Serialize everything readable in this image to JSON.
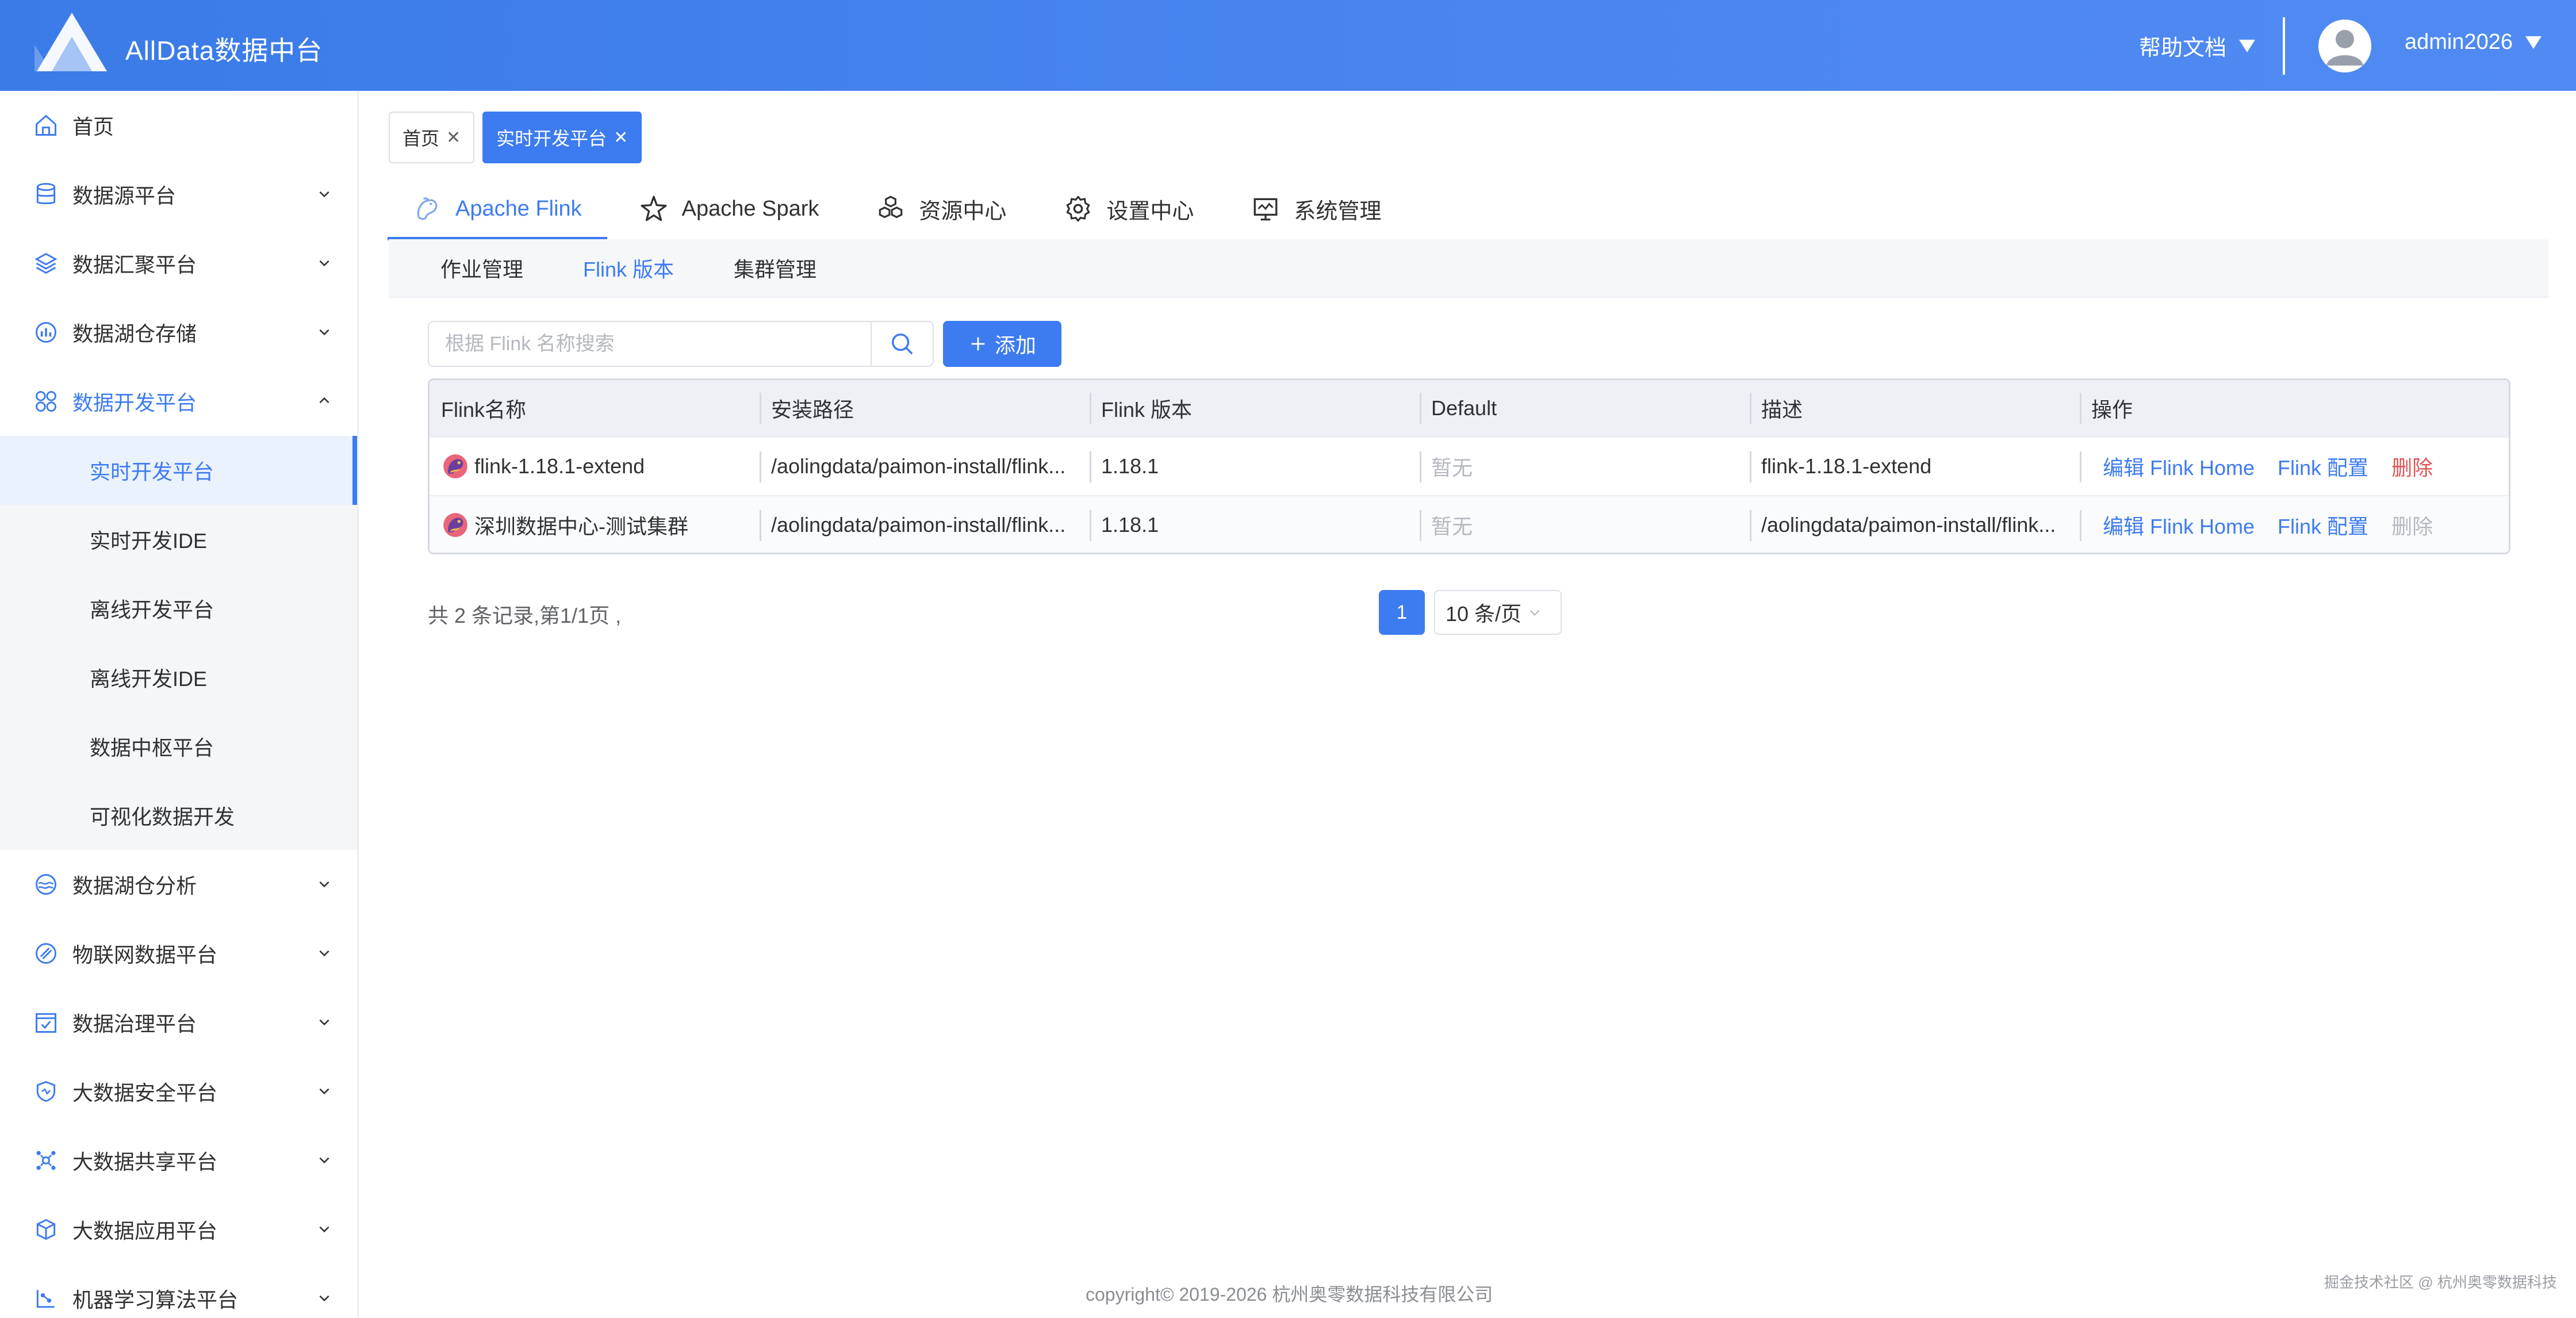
{
  "header": {
    "app_title": "AllData数据中台",
    "help_label": "帮助文档",
    "username": "admin2026"
  },
  "sidebar": {
    "items": [
      {
        "label": "首页",
        "icon": "home-icon"
      },
      {
        "label": "数据源平台",
        "icon": "database-icon"
      },
      {
        "label": "数据汇聚平台",
        "icon": "layers-icon"
      },
      {
        "label": "数据湖仓存储",
        "icon": "chart-circle-icon"
      },
      {
        "label": "数据开发平台",
        "icon": "grid-icon",
        "expanded": true
      },
      {
        "label": "数据湖仓分析",
        "icon": "lake-icon"
      },
      {
        "label": "物联网数据平台",
        "icon": "iot-icon"
      },
      {
        "label": "数据治理平台",
        "icon": "checklist-icon"
      },
      {
        "label": "大数据安全平台",
        "icon": "shield-icon"
      },
      {
        "label": "大数据共享平台",
        "icon": "share-icon"
      },
      {
        "label": "大数据应用平台",
        "icon": "cube-icon"
      },
      {
        "label": "机器学习算法平台",
        "icon": "ml-icon"
      }
    ],
    "subitems": [
      {
        "label": "实时开发平台",
        "selected": true
      },
      {
        "label": "实时开发IDE"
      },
      {
        "label": "离线开发平台"
      },
      {
        "label": "离线开发IDE"
      },
      {
        "label": "数据中枢平台"
      },
      {
        "label": "可视化数据开发"
      }
    ]
  },
  "tags": [
    {
      "label": "首页"
    },
    {
      "label": "实时开发平台",
      "active": true
    }
  ],
  "tabs": [
    {
      "label": "Apache Flink",
      "icon": "flink-squirrel-icon",
      "active": true
    },
    {
      "label": "Apache Spark",
      "icon": "spark-star-icon"
    },
    {
      "label": "资源中心",
      "icon": "resource-cubes-icon"
    },
    {
      "label": "设置中心",
      "icon": "settings-gear-icon"
    },
    {
      "label": "系统管理",
      "icon": "monitor-icon"
    }
  ],
  "subtabs": [
    {
      "label": "作业管理"
    },
    {
      "label": "Flink 版本",
      "active": true
    },
    {
      "label": "集群管理"
    }
  ],
  "search": {
    "placeholder": "根据 Flink 名称搜索",
    "value": ""
  },
  "add_label": "添加",
  "table": {
    "columns": [
      "Flink名称",
      "安装路径",
      "Flink 版本",
      "Default",
      "描述",
      "操作"
    ],
    "rows": [
      {
        "name": "flink-1.18.1-extend",
        "path": "/aolingdata/paimon-install/flink...",
        "version": "1.18.1",
        "default": "暂无",
        "description": "flink-1.18.1-extend",
        "delete_enabled": true
      },
      {
        "name": "深圳数据中心-测试集群",
        "path": "/aolingdata/paimon-install/flink...",
        "version": "1.18.1",
        "default": "暂无",
        "description": "/aolingdata/paimon-install/flink...",
        "delete_enabled": false
      }
    ],
    "actions": {
      "edit_home": "编辑 Flink Home",
      "config": "Flink 配置",
      "delete": "删除"
    }
  },
  "pagination": {
    "summary": "共 2 条记录,第1/1页 ,",
    "current_page": "1",
    "page_size": "10 条/页"
  },
  "footer": {
    "copyright": "copyright© 2019-2026 杭州奥零数据科技有限公司",
    "watermark": "掘金技术社区 @ 杭州奥零数据科技"
  },
  "colors": {
    "primary": "#3d7bf0",
    "header_gradient_start": "#3a7be8",
    "danger": "#e05555",
    "muted": "#b5b8bf"
  }
}
